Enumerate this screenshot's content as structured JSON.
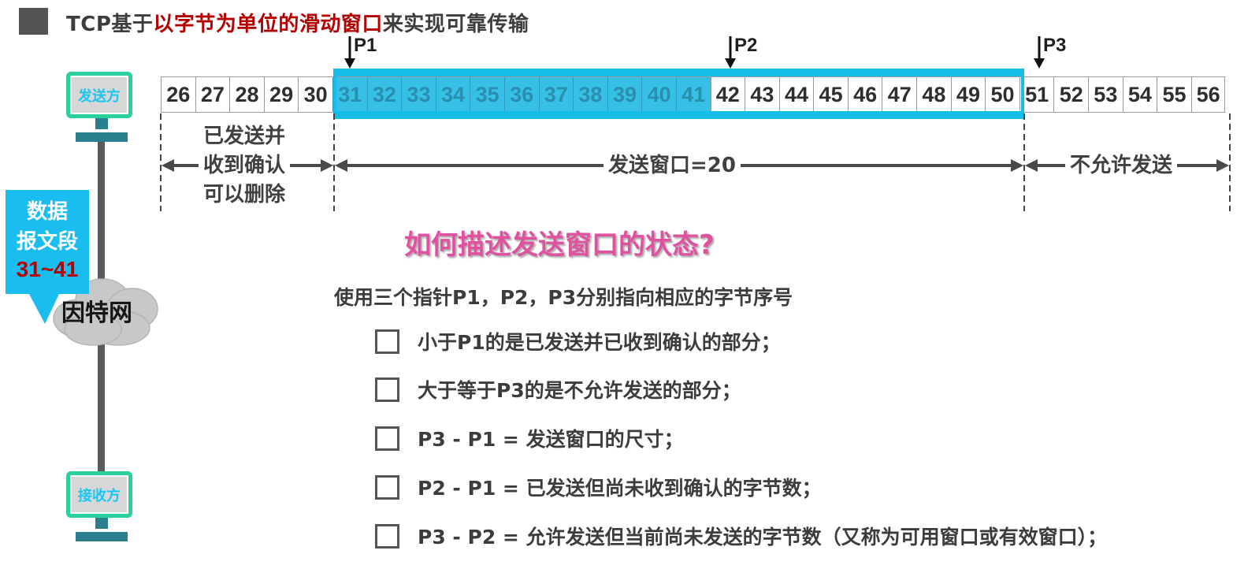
{
  "title": {
    "prefix": "TCP基于",
    "highlight": "以字节为单位的滑动窗口",
    "suffix": "来实现可靠传输"
  },
  "bytes": [
    "26",
    "27",
    "28",
    "29",
    "30",
    "31",
    "32",
    "33",
    "34",
    "35",
    "36",
    "37",
    "38",
    "39",
    "40",
    "41",
    "42",
    "43",
    "44",
    "45",
    "46",
    "47",
    "48",
    "49",
    "50",
    "51",
    "52",
    "53",
    "54",
    "55",
    "56"
  ],
  "sent_unacked": [
    "31",
    "32",
    "33",
    "34",
    "35",
    "36",
    "37",
    "38",
    "39",
    "40",
    "41"
  ],
  "pointers": {
    "p1": "P1",
    "p2": "P2",
    "p3": "P3"
  },
  "regions": {
    "acked_line1": "已发送并",
    "acked_line2": "收到确认",
    "acked_line3": "可以删除",
    "window": "发送窗口=20",
    "not_allowed": "不允许发送"
  },
  "sender": {
    "label": "发送方"
  },
  "receiver": {
    "label": "接收方"
  },
  "segment": {
    "line1": "数据",
    "line2": "报文段",
    "range": "31~41"
  },
  "network": {
    "label": "因特网"
  },
  "question": "如何描述发送窗口的状态?",
  "intro": "使用三个指针P1，P2，P3分别指向相应的字节序号",
  "items": [
    "小于P1的是已发送并已收到确认的部分；",
    "大于等于P3的是不允许发送的部分；",
    "P3 - P1 = 发送窗口的尺寸；",
    "P2 - P1 = 已发送但尚未收到确认的字节数；",
    "P3 - P2 = 允许发送但当前尚未发送的字节数（又称为可用窗口或有效窗口）；"
  ],
  "colors": {
    "window_border": "#17bde9",
    "sent_fill": "#37c0e6",
    "highlight_red": "#b30000",
    "question_pink": "#e0529f",
    "device_green": "#2ad09d",
    "segment_blue": "#19bdf0"
  }
}
